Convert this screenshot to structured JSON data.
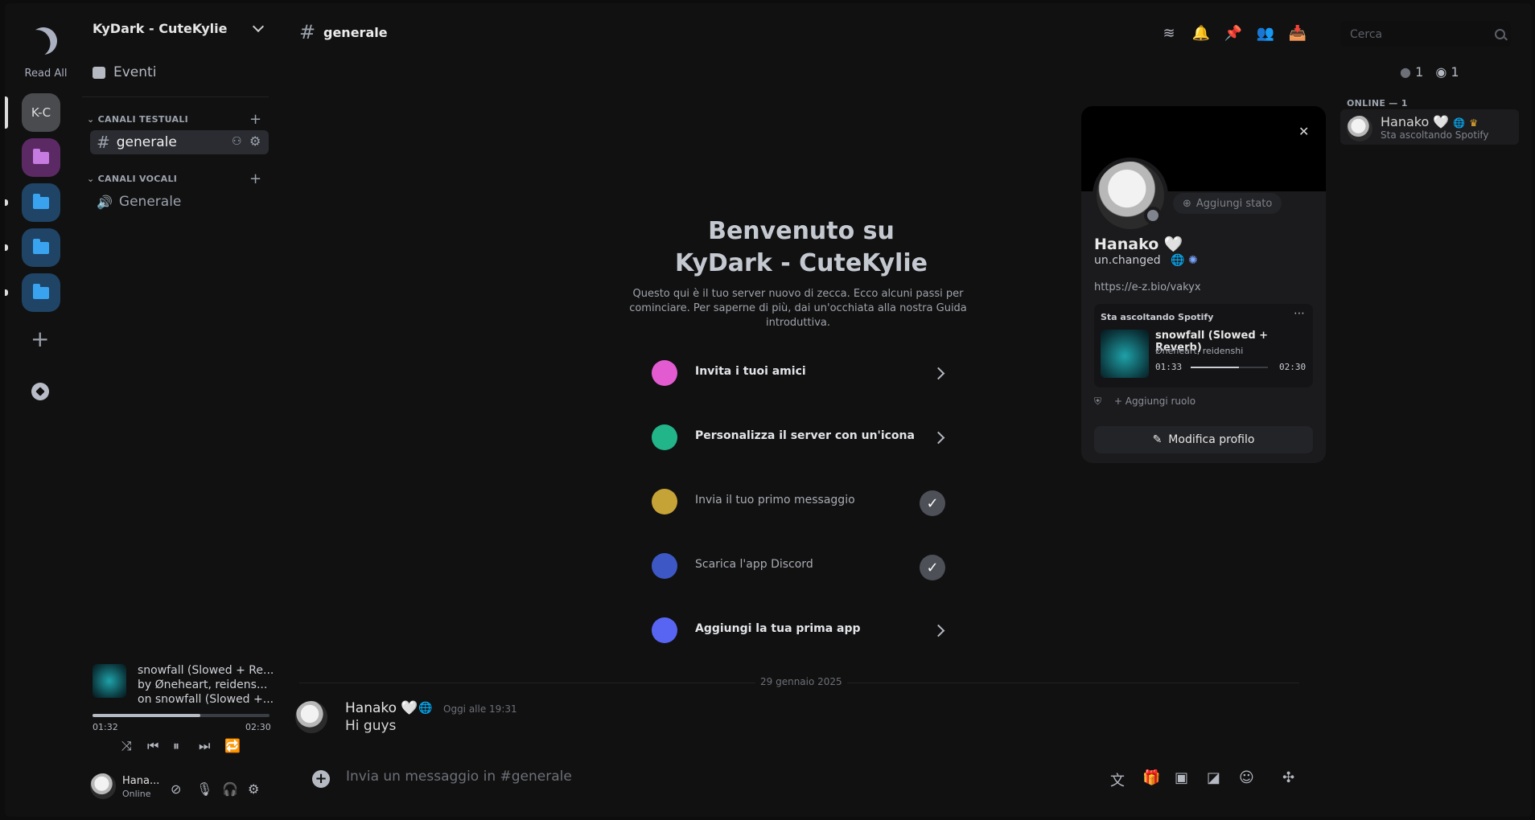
{
  "rail": {
    "read_all": "Read All",
    "servers": [
      {
        "label": "K-C",
        "color": "#4a4b4f"
      },
      {
        "label": "",
        "color": "#5b2a64",
        "folder": "#c57be0"
      },
      {
        "label": "",
        "color": "#1f4466",
        "folder": "#3aa3f0"
      },
      {
        "label": "",
        "color": "#1f4466",
        "folder": "#3aa3f0"
      },
      {
        "label": "",
        "color": "#1f4466",
        "folder": "#3aa3f0"
      }
    ],
    "add_symbol": "+"
  },
  "sidebar": {
    "server_name": "KyDark - CuteKylie",
    "events": "Eventi",
    "text_category": "CANALI TESTUALI",
    "voice_category": "CANALI VOCALI",
    "text_channels": [
      {
        "name": "generale",
        "prefix": "#"
      }
    ],
    "voice_channels": [
      {
        "name": "Generale"
      }
    ],
    "now_playing": {
      "title": "snowfall (Slowed + Re...",
      "artist": "by Øneheart, reidens...",
      "album": "on snowfall (Slowed +...",
      "elapsed": "01:32",
      "duration": "02:30",
      "progress": 0.61
    },
    "user": {
      "name": "Hana...",
      "status": "Online"
    }
  },
  "header": {
    "channel_prefix": "#",
    "channel": "generale",
    "search_placeholder": "Cerca"
  },
  "welcome": {
    "title_line1": "Benvenuto su",
    "title_line2": "KyDark - CuteKylie",
    "description": "Questo qui è il tuo server nuovo di zecca. Ecco alcuni passi per cominciare. Per saperne di più, dai un'occhiata alla nostra Guida introduttiva.",
    "tasks": [
      {
        "label": "Invita i tuoi amici",
        "done": false,
        "icon_color": "#e35bd0"
      },
      {
        "label": "Personalizza il server con un'icona",
        "done": false,
        "icon_color": "#23b58a"
      },
      {
        "label": "Invia il tuo primo messaggio",
        "done": true,
        "icon_color": "#c6a336"
      },
      {
        "label": "Scarica l'app Discord",
        "done": true,
        "icon_color": "#3d58c4"
      },
      {
        "label": "Aggiungi la tua prima app",
        "done": false,
        "icon_color": "#5865f2"
      }
    ]
  },
  "messages": {
    "date": "29 gennaio 2025",
    "author": "Hanako 🤍",
    "time": "Oggi alle 19:31",
    "text": "Hi guys"
  },
  "composer": {
    "placeholder": "Invia un messaggio in #generale"
  },
  "profile": {
    "add_status": "Aggiungi stato",
    "name": "Hanako 🤍",
    "username": "un.changed",
    "link": "https://e-z.bio/vakyx",
    "spotify": {
      "heading": "Sta ascoltando Spotify",
      "song": "snowfall (Slowed + Reverb)",
      "artists": "Øneheart, reidenshi",
      "elapsed": "01:33",
      "duration": "02:30",
      "progress": 0.62
    },
    "add_role": "Aggiungi ruolo",
    "edit_profile": "Modifica profilo"
  },
  "members": {
    "count_a": "1",
    "count_b": "1",
    "online_header": "ONLINE — 1",
    "list": [
      {
        "name": "Hanako 🤍",
        "activity": "Sta ascoltando Spotify"
      }
    ]
  }
}
